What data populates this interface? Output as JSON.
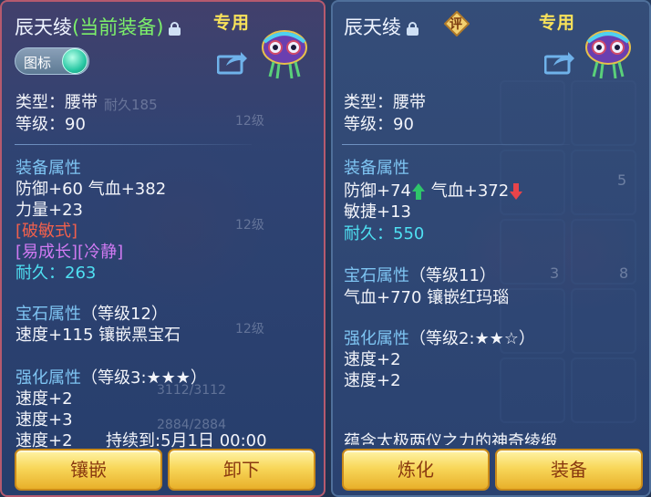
{
  "left_panel": {
    "title_name": "辰天绫",
    "title_status": "(当前装备)",
    "exclusive_label": "专用",
    "toggle_label": "图标",
    "type_line": "类型：腰带",
    "level_line": "等级：90",
    "equip_attr_header": "装备属性",
    "attr_line1": "防御+60 气血+382",
    "attr_line2": "力量+23",
    "special1": "[破敏式]",
    "special2": "[易成长][冷静]",
    "durability": "耐久：263",
    "gem_header": "宝石属性",
    "gem_level": "（等级12）",
    "gem_line": "速度+115 镶嵌黑宝石",
    "enhance_header": "强化属性",
    "enhance_level": "（等级3:★★★）",
    "enhance_line1": "速度+2",
    "enhance_line2": "速度+3",
    "enhance_line3": "速度+2",
    "duration": "持续到:5月1日 00:00",
    "button_inlay": "镶嵌",
    "button_unequip": "卸下"
  },
  "right_panel": {
    "title_name": "辰天绫",
    "badge": "评",
    "exclusive_label": "专用",
    "type_line": "类型：腰带",
    "level_line": "等级：90",
    "equip_attr_header": "装备属性",
    "attr_defense": "防御+74",
    "attr_hp": "气血+372",
    "attr_line2": "敏捷+13",
    "durability": "耐久：550",
    "gem_header": "宝石属性",
    "gem_level": "（等级11）",
    "gem_line": "气血+770 镶嵌红玛瑙",
    "enhance_header": "强化属性",
    "enhance_level": "（等级2:★★☆）",
    "enhance_line1": "速度+2",
    "enhance_line2": "速度+2",
    "description": "蕴含太极两仪之力的神奇绫缎",
    "button_refine": "炼化",
    "button_equip": "装备"
  },
  "background": {
    "durability_text": "耐久185",
    "slot_level_a": "12级",
    "slot_level_b": "12级",
    "slot_level_c": "12级",
    "slot_level_d": "12级",
    "bar_a": "3112/3112",
    "bar_b": "2884/2884",
    "num_3": "3",
    "num_5": "5",
    "num_8": "8"
  },
  "colors": {
    "accent_yellow": "#f8e25a",
    "section_blue": "#7ec4f2",
    "durability_cyan": "#4fe0f2",
    "special_red": "#f2604c",
    "special_purple": "#d07af2",
    "title_green": "#7cf06a",
    "up_arrow": "#2ec46a",
    "down_arrow": "#e8444a"
  },
  "icons": [
    "lock-icon",
    "share-icon",
    "mask-icon",
    "toggle-knob",
    "arrow-up-icon",
    "arrow-down-icon"
  ]
}
